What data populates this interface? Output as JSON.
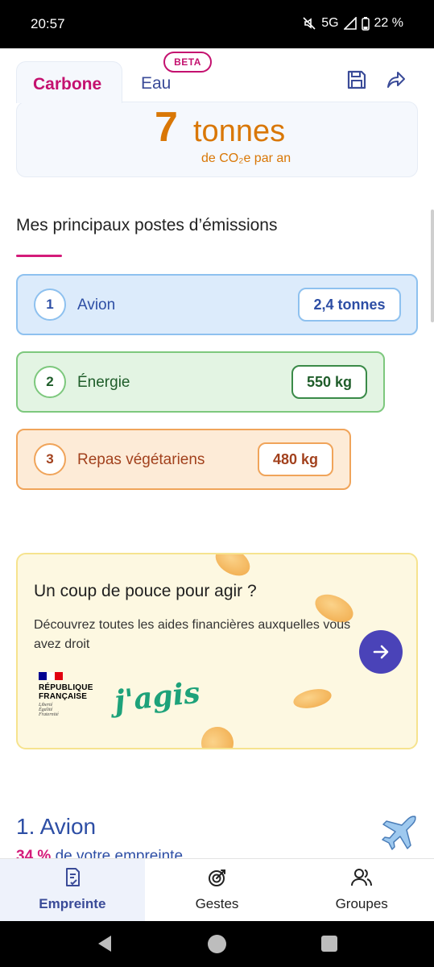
{
  "status_bar": {
    "time": "20:57",
    "network": "5G",
    "battery": "22 %"
  },
  "tabs": [
    {
      "label": "Carbone",
      "active": true
    },
    {
      "label": "Eau",
      "active": false,
      "badge": "BETA"
    }
  ],
  "summary": {
    "value": "7",
    "unit": "tonnes",
    "subtitle": "de CO₂e par an"
  },
  "section": {
    "title": "Mes principaux postes d’émissions"
  },
  "emissions": [
    {
      "rank": "1",
      "label": "Avion",
      "value": "2,4 tonnes"
    },
    {
      "rank": "2",
      "label": "Énergie",
      "value": "550 kg"
    },
    {
      "rank": "3",
      "label": "Repas végétariens",
      "value": "480 kg"
    }
  ],
  "promo": {
    "title": "Un coup de pouce pour agir ?",
    "text": "Découvrez toutes les aides financières auxquelles vous avez droit",
    "gov_name_line1": "RÉPUBLIQUE",
    "gov_name_line2": "FRANÇAISE",
    "gov_motto": "Liberté Égalité Fraternité",
    "partner_logo": "j'agis"
  },
  "detail": {
    "title": "1. Avion",
    "percent": "34 %",
    "percent_text": " de votre empreinte"
  },
  "bottom_nav": [
    {
      "label": "Empreinte",
      "icon": "document-check-icon",
      "active": true
    },
    {
      "label": "Gestes",
      "icon": "target-icon",
      "active": false
    },
    {
      "label": "Groupes",
      "icon": "users-icon",
      "active": false
    }
  ],
  "colors": {
    "brand_pink": "#c4116f",
    "primary_blue": "#3a4b98",
    "orange": "#d97706",
    "promo_button": "#4a43b8"
  }
}
